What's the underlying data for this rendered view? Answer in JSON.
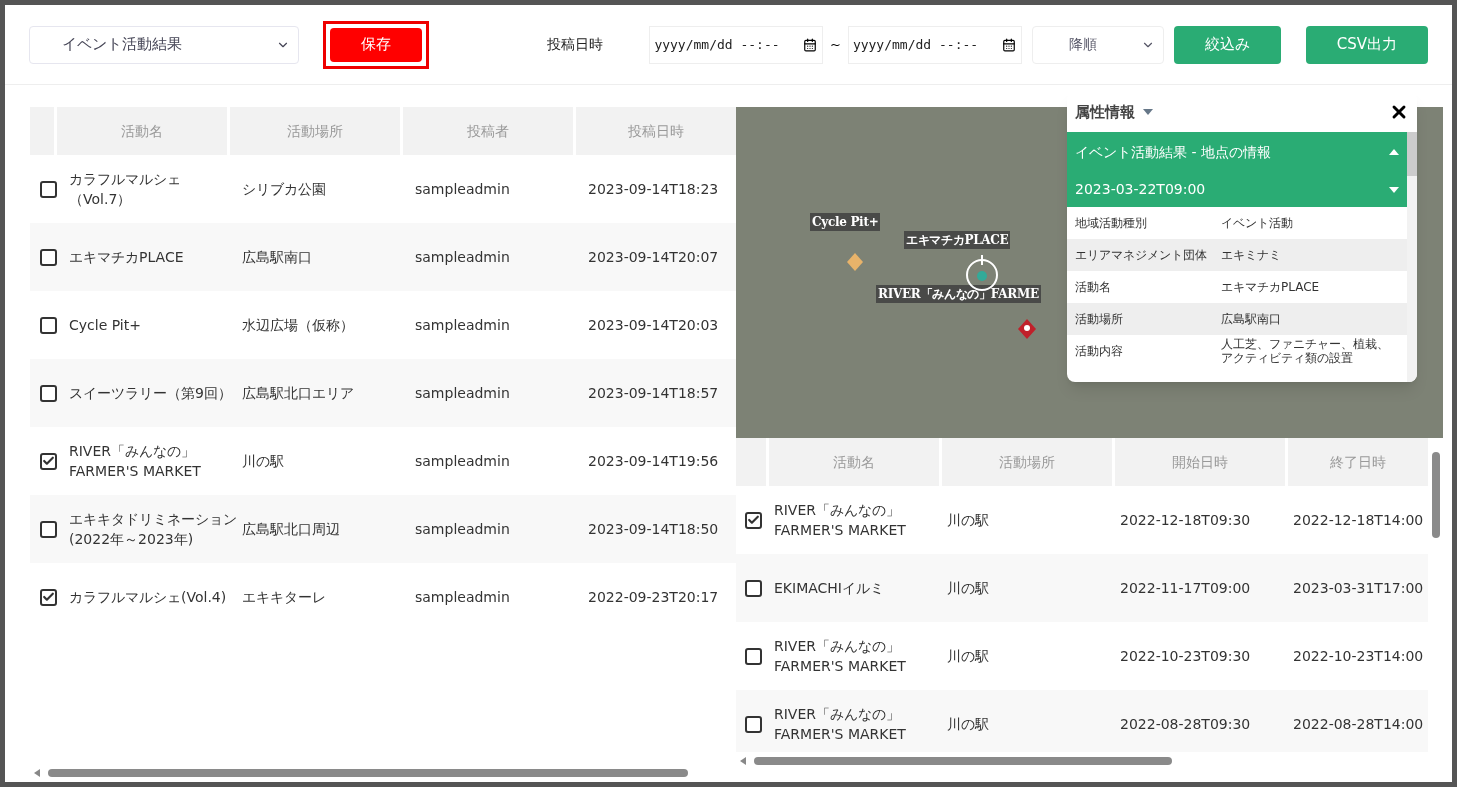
{
  "toolbar": {
    "layer_select": "イベント活動結果",
    "save_button": {
      "label": "保存",
      "highlighted": true
    },
    "date_label": "投稿日時",
    "date_from": {
      "placeholder": "yyyy/mm/dd --:--"
    },
    "range_sep": "~",
    "date_to": {
      "placeholder": "yyyy/mm/dd --:--"
    },
    "order_select": "降順",
    "filter_button": "絞込み",
    "csv_button": "CSV出力"
  },
  "main_table": {
    "columns": [
      "活動名",
      "活動場所",
      "投稿者",
      "投稿日時"
    ],
    "rows": [
      {
        "checked": false,
        "cells": [
          "カラフルマルシェ（Vol.7）",
          "シリブカ公園",
          "sampleadmin",
          "2023-09-14T18:23"
        ]
      },
      {
        "checked": false,
        "cells": [
          "エキマチカPLACE",
          "広島駅南口",
          "sampleadmin",
          "2023-09-14T20:07"
        ]
      },
      {
        "checked": false,
        "cells": [
          "Cycle Pit+",
          "水辺広場（仮称）",
          "sampleadmin",
          "2023-09-14T20:03"
        ]
      },
      {
        "checked": false,
        "cells": [
          "スイーツラリー（第9回）",
          "広島駅北口エリア",
          "sampleadmin",
          "2023-09-14T18:57"
        ]
      },
      {
        "checked": true,
        "cells": [
          "RIVER「みんなの」FARMER'S MARKET",
          "川の駅",
          "sampleadmin",
          "2023-09-14T19:56"
        ]
      },
      {
        "checked": false,
        "cells": [
          "エキキタドリミネーション(2022年～2023年)",
          "広島駅北口周辺",
          "sampleadmin",
          "2023-09-14T18:50"
        ]
      },
      {
        "checked": true,
        "cells": [
          "カラフルマルシェ(Vol.4)",
          "エキキターレ",
          "sampleadmin",
          "2022-09-23T20:17"
        ]
      }
    ]
  },
  "map": {
    "labels": [
      {
        "text": "Cycle Pit+",
        "kind": "plain"
      },
      {
        "text": "エキマチカPLACE",
        "kind": "target"
      },
      {
        "text": "RIVER「みんなの」FARME",
        "kind": "plain"
      }
    ]
  },
  "attribute_panel": {
    "title": "属性情報",
    "section": "イベント活動結果 - 地点の情報",
    "record": "2023-03-22T09:00",
    "fields": [
      {
        "key": "地域活動種別",
        "value": "イベント活動"
      },
      {
        "key": "エリアマネジメント団体",
        "value": "エキミナミ"
      },
      {
        "key": "活動名",
        "value": "エキマチカPLACE"
      },
      {
        "key": "活動場所",
        "value": "広島駅南口"
      },
      {
        "key": "活動内容",
        "value": "人工芝、ファニチャー、植栽、アクティビティ類の設置"
      }
    ]
  },
  "sub_table": {
    "columns": [
      "活動名",
      "活動場所",
      "開始日時",
      "終了日時"
    ],
    "rows": [
      {
        "checked": true,
        "cells": [
          "RIVER「みんなの」FARMER'S MARKET",
          "川の駅",
          "2022-12-18T09:30",
          "2022-12-18T14:00"
        ]
      },
      {
        "checked": false,
        "cells": [
          "EKIMACHIイルミ",
          "川の駅",
          "2022-11-17T09:00",
          "2023-03-31T17:00"
        ]
      },
      {
        "checked": false,
        "cells": [
          "RIVER「みんなの」FARMER'S MARKET",
          "川の駅",
          "2022-10-23T09:30",
          "2022-10-23T14:00"
        ]
      },
      {
        "checked": false,
        "cells": [
          "RIVER「みんなの」FARMER'S MARKET",
          "川の駅",
          "2022-08-28T09:30",
          "2022-08-28T14:00"
        ]
      }
    ]
  }
}
